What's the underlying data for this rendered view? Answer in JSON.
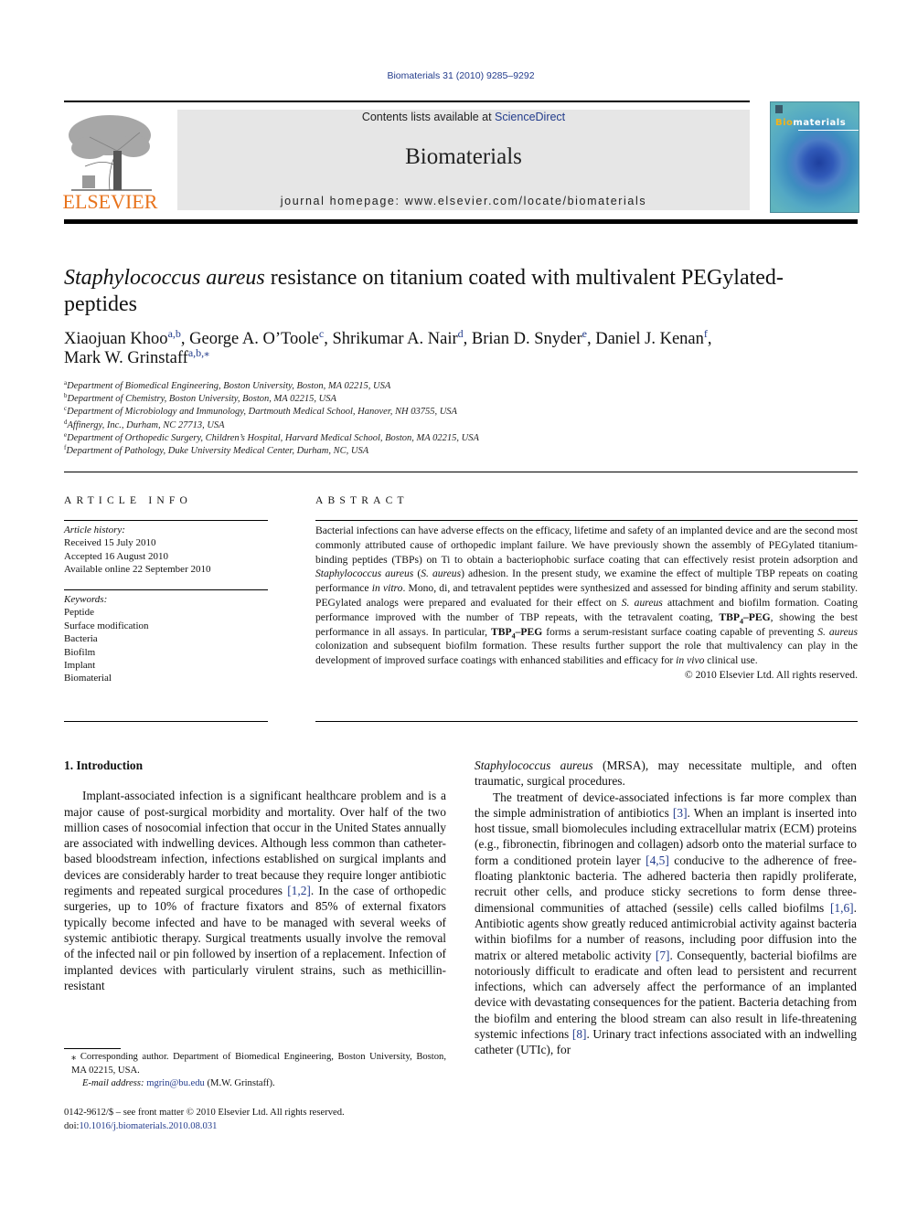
{
  "header": {
    "citation": "Biomaterials 31 (2010) 9285–9292",
    "contents_prefix": "Contents lists available at ",
    "contents_link": "ScienceDirect",
    "journal_title": "Biomaterials",
    "homepage": "journal homepage: www.elsevier.com/locate/biomaterials",
    "publisher_logo_text": "ELSEVIER",
    "cover": {
      "title_highlight": "Bio",
      "title_rest": "materials",
      "accent_color": "#f3b21a"
    }
  },
  "article": {
    "title_italic": "Staphylococcus aureus",
    "title_rest": " resistance on titanium coated with multivalent PEGylated-peptides",
    "authors": [
      {
        "name": "Xiaojuan Khoo",
        "sup": "a,b",
        "sep": ", "
      },
      {
        "name": "George A. O’Toole",
        "sup": "c",
        "sep": ", "
      },
      {
        "name": "Shrikumar A. Nair",
        "sup": "d",
        "sep": ", "
      },
      {
        "name": "Brian D. Snyder",
        "sup": "e",
        "sep": ", "
      },
      {
        "name": "Daniel J. Kenan",
        "sup": "f",
        "sep": ","
      },
      {
        "name": "Mark W. Grinstaff",
        "sup": "a,b,⁎",
        "sep": ""
      }
    ],
    "affiliations": [
      {
        "key": "a",
        "text": "Department of Biomedical Engineering, Boston University, Boston, MA 02215, USA"
      },
      {
        "key": "b",
        "text": "Department of Chemistry, Boston University, Boston, MA 02215, USA"
      },
      {
        "key": "c",
        "text": "Department of Microbiology and Immunology, Dartmouth Medical School, Hanover, NH 03755, USA"
      },
      {
        "key": "d",
        "text": "Affinergy, Inc., Durham, NC 27713, USA"
      },
      {
        "key": "e",
        "text": "Department of Orthopedic Surgery, Children’s Hospital, Harvard Medical School, Boston, MA 02215, USA"
      },
      {
        "key": "f",
        "text": "Department of Pathology, Duke University Medical Center, Durham, NC, USA"
      }
    ]
  },
  "article_info": {
    "heading": "ARTICLE INFO",
    "history_label": "Article history:",
    "history": [
      "Received 15 July 2010",
      "Accepted 16 August 2010",
      "Available online 22 September 2010"
    ],
    "keywords_label": "Keywords:",
    "keywords": [
      "Peptide",
      "Surface modification",
      "Bacteria",
      "Biofilm",
      "Implant",
      "Biomaterial"
    ]
  },
  "abstract": {
    "heading": "ABSTRACT",
    "p1": "Bacterial infections can have adverse effects on the efficacy, lifetime and safety of an implanted device and are the second most commonly attributed cause of orthopedic implant failure. We have previously shown the assembly of PEGylated titanium-binding peptides (TBPs) on Ti to obtain a bacteriophobic surface coating that can effectively resist protein adsorption and ",
    "p1_i1": "Staphylococcus aureus",
    "p1_b": " (",
    "p1_i2": "S. aureus",
    "p1_c": ") adhesion. In the present study, we examine the effect of multiple TBP repeats on coating performance ",
    "p1_i3": "in vitro",
    "p1_d": ". Mono, di, and tetravalent peptides were synthesized and assessed for binding affinity and serum stability. PEGylated analogs were prepared and evaluated for their effect on ",
    "p1_i4": "S. aureus",
    "p1_e": " attachment and biofilm formation. Coating performance improved with the number of TBP repeats, with the tetravalent coating, ",
    "bold_compound_base": "TBP",
    "bold_compound_sub": "4",
    "bold_compound_tail": "–PEG",
    "p1_f": ", showing the best performance in all assays. In particular, ",
    "p1_g": " forms a serum-resistant surface coating capable of preventing ",
    "p1_i5": "S. aureus",
    "p1_h": " colonization and subsequent biofilm formation. These results further support the role that multivalency can play in the development of improved surface coatings with enhanced stabilities and efficacy for ",
    "p1_i6": "in vivo",
    "p1_end": " clinical use.",
    "copyright": "© 2010 Elsevier Ltd. All rights reserved."
  },
  "body": {
    "section_heading": "1.  Introduction",
    "left_p1_a": "Implant-associated infection is a significant healthcare problem and is a major cause of post-surgical morbidity and mortality. Over half of the two million cases of nosocomial infection that occur in the United States annually are associated with indwelling devices. Although less common than catheter-based bloodstream infection, infections established on surgical implants and devices are considerably harder to treat because they require longer antibiotic regiments and repeated surgical procedures ",
    "ref_1_2": "[1,2]",
    "left_p1_b": ". In the case of orthopedic surgeries, up to 10% of fracture fixators and 85% of external fixators typically become infected and have to be managed with several weeks of systemic antibiotic therapy. Surgical treat­ments usually involve the removal of the infected nail or pin fol­lowed by insertion of a replacement. Infection of implanted devices with particularly virulent strains, such as methicillin-resistant",
    "right_p0_italic": "Staphylococcus aureus",
    "right_p0": " (MRSA), may necessitate multiple, and often traumatic, surgical procedures.",
    "right_p1_a": "The treatment of device-associated infections is far more complex than the simple administration of antibiotics ",
    "ref_3": "[3]",
    "right_p1_b": ". When an implant is inserted into host tissue, small biomolecules including extracellular matrix (ECM) proteins (e.g., fibronectin, fibrinogen and collagen) adsorb onto the material surface to form a condi­tioned protein layer ",
    "ref_4_5": "[4,5]",
    "right_p1_c": " conducive to the adherence of free-floating planktonic bacteria. The adhered bacteria then rapidly proliferate, recruit other cells, and produce sticky secretions to form dense three-dimensional communities of attached (sessile) cells called biofilms ",
    "ref_1_6": "[1,6]",
    "right_p1_d": ". Antibiotic agents show greatly reduced anti­microbial activity against bacteria within biofilms for a number of reasons, including poor diffusion into the matrix or altered meta­bolic activity ",
    "ref_7": "[7]",
    "right_p1_e": ". Consequently, bacterial biofilms are notoriously difficult to eradicate and often lead to persistent and recurrent infections, which can adversely affect the performance of an implanted device with devastating consequences for the patient. Bacteria detaching from the biofilm and entering the blood stream can also result in life-threatening systemic infections ",
    "ref_8": "[8]",
    "right_p1_f": ". Urinary tract infections associated with an indwelling catheter (UTIc), for"
  },
  "footnotes": {
    "star_text": "⁎ Corresponding author. Department of Biomedical Engineering, Boston Univer­sity, Boston, MA 02215, USA.",
    "email_label": "E-mail address: ",
    "email": "mgrin@bu.edu",
    "email_suffix": " (M.W. Grinstaff).",
    "front_matter": "0142-9612/$ – see front matter © 2010 Elsevier Ltd. All rights reserved.",
    "doi_label": "doi:",
    "doi": "10.1016/j.biomaterials.2010.08.031"
  },
  "colors": {
    "link": "#233c8c",
    "elsevier_orange": "#e8731c",
    "banner_bg": "#e6e6e6"
  }
}
